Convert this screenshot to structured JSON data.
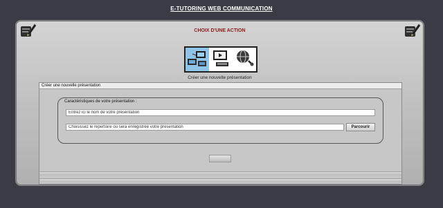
{
  "app": {
    "title": "E-TUTORING WEB COMMUNICATION"
  },
  "panel": {
    "heading": "CHOIX D'UNE ACTION"
  },
  "actions": {
    "items": [
      {
        "icon": "presentation-create-icon",
        "active": true
      },
      {
        "icon": "video-play-icon",
        "active": false
      },
      {
        "icon": "globe-network-icon",
        "active": false
      }
    ],
    "caption": "Créer une nouvelle présentation"
  },
  "form": {
    "section_title": "Créer une nouvelle présentation",
    "legend": "Caractéristiques de votre présentation :",
    "name_field": {
      "value": "Entrez ici le nom de votre présentation"
    },
    "directory_field": {
      "value": "Choisissez le répertoire où sera enregistrée votre présentation"
    },
    "browse_label": "Parcourir"
  },
  "colors": {
    "heading": "#8b1a1a",
    "active_tile": "#8fc4e8",
    "page_bg": "#3a3b45"
  }
}
